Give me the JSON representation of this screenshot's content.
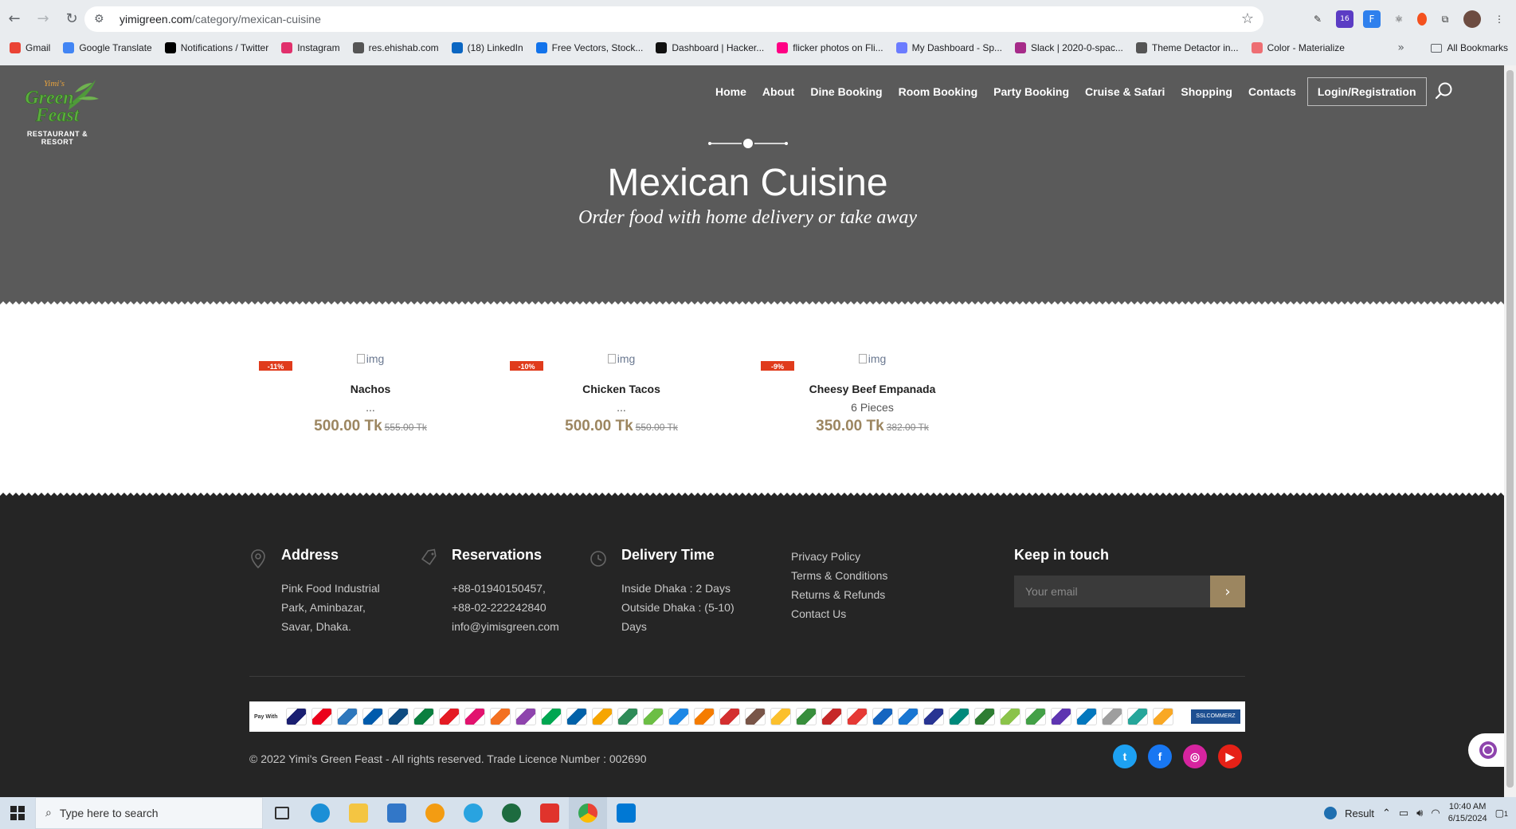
{
  "browser": {
    "url_host": "yimigreen.com",
    "url_path": "/category/mexican-cuisine",
    "bookmarks": [
      {
        "label": "Gmail",
        "color": "#ea4335"
      },
      {
        "label": "Google Translate",
        "color": "#4285f4"
      },
      {
        "label": "Notifications / Twitter",
        "color": "#000000"
      },
      {
        "label": "Instagram",
        "color": "#e1306c"
      },
      {
        "label": "res.ehishab.com",
        "color": "#555555"
      },
      {
        "label": "(18) LinkedIn",
        "color": "#0a66c2"
      },
      {
        "label": "Free Vectors, Stock...",
        "color": "#1273eb"
      },
      {
        "label": "Dashboard | Hacker...",
        "color": "#111111"
      },
      {
        "label": "flicker photos on Fli...",
        "color": "#ff0084"
      },
      {
        "label": "My Dashboard - Sp...",
        "color": "#6b7cff"
      },
      {
        "label": "Slack | 2020-0-spac...",
        "color": "#a62b89"
      },
      {
        "label": "Theme Detactor in...",
        "color": "#555555"
      },
      {
        "label": "Color - Materialize",
        "color": "#ee6e73"
      }
    ],
    "all_bookmarks": "All Bookmarks",
    "ext_badge": "16"
  },
  "site": {
    "logo_title": "Yimi's Green Feast",
    "logo_subtitle": "RESTAURANT & RESORT",
    "nav": [
      "Home",
      "About",
      "Dine Booking",
      "Room Booking",
      "Party Booking",
      "Cruise & Safari",
      "Shopping",
      "Contacts"
    ],
    "login_label": "Login/Registration"
  },
  "hero": {
    "title": "Mexican Cuisine",
    "subtitle": "Order food with home delivery or take away"
  },
  "products": [
    {
      "badge": "-11%",
      "img_alt": "img",
      "name": "Nachos",
      "desc": "...",
      "price": "500.00 Tk",
      "old_price": "555.00 Tk"
    },
    {
      "badge": "-10%",
      "img_alt": "img",
      "name": "Chicken Tacos",
      "desc": "...",
      "price": "500.00 Tk",
      "old_price": "550.00 Tk"
    },
    {
      "badge": "-9%",
      "img_alt": "img",
      "name": "Cheesy Beef Empanada",
      "desc": "6 Pieces",
      "price": "350.00 Tk",
      "old_price": "382.00 Tk"
    }
  ],
  "footer": {
    "address": {
      "title": "Address",
      "lines": [
        "Pink Food Industrial",
        "Park, Aminbazar,",
        "Savar, Dhaka."
      ]
    },
    "reservations": {
      "title": "Reservations",
      "lines": [
        "+88-01940150457,",
        "+88-02-222242840",
        "info@yimisgreen.com"
      ]
    },
    "delivery": {
      "title": "Delivery Time",
      "lines": [
        "Inside Dhaka : 2 Days",
        "Outside Dhaka : (5-10)",
        "Days"
      ]
    },
    "links": [
      "Privacy Policy",
      "Terms & Conditions",
      "Returns & Refunds",
      "Contact Us"
    ],
    "keep_title": "Keep in touch",
    "email_placeholder": "Your email",
    "pay_with": "Pay With",
    "verified": "SSLCOMMERZ",
    "copyright": "© 2022 Yimi's Green Feast - All rights reserved. Trade Licence Number : 002690",
    "socials": [
      {
        "name": "twitter",
        "color": "#1da1f2",
        "glyph": "t"
      },
      {
        "name": "facebook",
        "color": "#1877f2",
        "glyph": "f"
      },
      {
        "name": "instagram",
        "color": "#d6249f",
        "glyph": "◎"
      },
      {
        "name": "youtube",
        "color": "#e62117",
        "glyph": "▶"
      }
    ]
  },
  "taskbar": {
    "search_placeholder": "Type here to search",
    "weather": "Result",
    "time": "10:40 AM",
    "date": "6/15/2024",
    "notif_count": "1"
  }
}
